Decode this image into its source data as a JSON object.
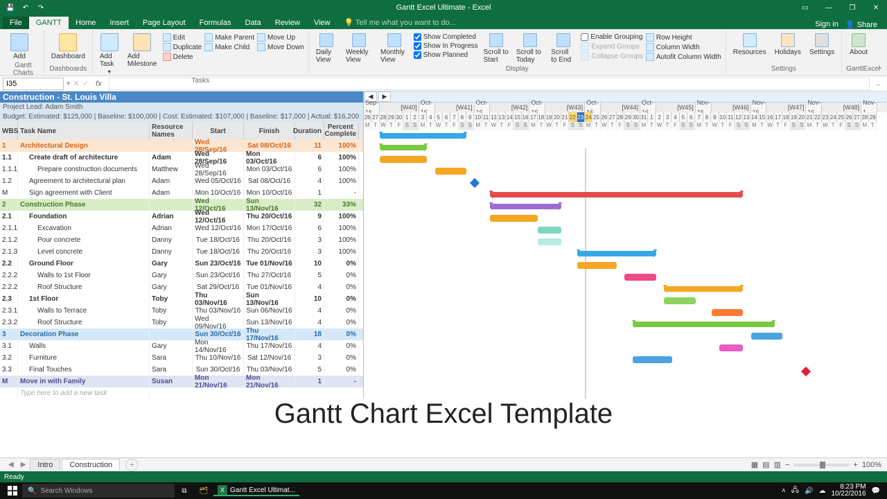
{
  "titlebar": {
    "title": "Gantt Excel Ultimate - Excel",
    "signin": "Sign in",
    "share": "Share"
  },
  "tabs": [
    "File",
    "GANTT",
    "Home",
    "Insert",
    "Page Layout",
    "Formulas",
    "Data",
    "Review",
    "View"
  ],
  "tell_me": "Tell me what you want to do...",
  "ribbon": {
    "gantt_charts": {
      "add": "Add",
      "label": "Gantt Charts"
    },
    "dashboards": {
      "dashboard": "Dashboard",
      "label": "Dashboards"
    },
    "tasks_big": {
      "add_task": "Add Task",
      "add_milestone": "Add Milestone"
    },
    "tasks_cmds": [
      "Edit",
      "Make Parent",
      "Move Up",
      "Duplicate",
      "Make Child",
      "Move Down",
      "Delete"
    ],
    "tasks_label": "Tasks",
    "views": [
      "Daily View",
      "Weekly View",
      "Monthly View"
    ],
    "display_checks": [
      "Show Completed",
      "Show In Progress",
      "Show Planned"
    ],
    "display_label": "Display",
    "scroll": [
      "Scroll to Start",
      "Scroll to Today",
      "Scroll to End"
    ],
    "grouping": [
      "Enable Grouping",
      "Expand Groups",
      "Collapse Groups"
    ],
    "row_cmds": [
      "Row Height",
      "Column Width",
      "Autofit Column Width"
    ],
    "resources": "Resources",
    "holidays": "Holidays",
    "settings": "Settings",
    "settings_label": "Settings",
    "about": "About",
    "about_label": "GanttExcel"
  },
  "formula_bar": {
    "name_box": "I35",
    "fx": "fx"
  },
  "project": {
    "title": "Construction - St. Louis Villa",
    "lead": "Project Lead: Adam Smith",
    "budget": "Budget:  Estimated: $125,000 |  Baseline: $100,000 |  Cost:  Estimated: $107,000 |  Baseline: $17,000 |  Actual: $16,200"
  },
  "columns": {
    "wbs": "WBS",
    "task": "Task Name",
    "res": "Resource Names",
    "start": "Start",
    "finish": "Finish",
    "dur": "Duration",
    "pct": "Percent Complete"
  },
  "placeholder_row": "Type here to add a new task",
  "rows": [
    {
      "wbs": "1",
      "task": "Architectural Design",
      "res": "",
      "start": "Wed 28/Sep/16",
      "finish": "Sat 08/Oct/16",
      "dur": "11",
      "pct": "100%",
      "cls": "phase-orange",
      "i": 0
    },
    {
      "wbs": "1.1",
      "task": "Create draft of architecture",
      "res": "Adam",
      "start": "Wed 28/Sep/16",
      "finish": "Mon 03/Oct/16",
      "dur": "6",
      "pct": "100%",
      "cls": "bold",
      "i": 1
    },
    {
      "wbs": "1.1.1",
      "task": "Prepare construction documents",
      "res": "Matthew",
      "start": "Wed 28/Sep/16",
      "finish": "Mon 03/Oct/16",
      "dur": "6",
      "pct": "100%",
      "i": 2
    },
    {
      "wbs": "1.2",
      "task": "Agreement to architectural plan",
      "res": "Adam",
      "start": "Wed 05/Oct/16",
      "finish": "Sat 08/Oct/16",
      "dur": "4",
      "pct": "100%",
      "i": 1
    },
    {
      "wbs": "M",
      "task": "Sign agreement with Client",
      "res": "Adam",
      "start": "Mon 10/Oct/16",
      "finish": "Mon 10/Oct/16",
      "dur": "1",
      "pct": "-",
      "i": 1
    },
    {
      "wbs": "2",
      "task": "Construction Phase",
      "res": "",
      "start": "Wed 12/Oct/16",
      "finish": "Sun 13/Nov/16",
      "dur": "32",
      "pct": "33%",
      "cls": "phase-green",
      "i": 0
    },
    {
      "wbs": "2.1",
      "task": "Foundation",
      "res": "Adrian",
      "start": "Wed 12/Oct/16",
      "finish": "Thu 20/Oct/16",
      "dur": "9",
      "pct": "100%",
      "cls": "bold",
      "i": 1
    },
    {
      "wbs": "2.1.1",
      "task": "Excavation",
      "res": "Adrian",
      "start": "Wed 12/Oct/16",
      "finish": "Mon 17/Oct/16",
      "dur": "6",
      "pct": "100%",
      "i": 2
    },
    {
      "wbs": "2.1.2",
      "task": "Pour concrete",
      "res": "Danny",
      "start": "Tue 18/Oct/16",
      "finish": "Thu 20/Oct/16",
      "dur": "3",
      "pct": "100%",
      "i": 2
    },
    {
      "wbs": "2.1.3",
      "task": "Level concrete",
      "res": "Danny",
      "start": "Tue 18/Oct/16",
      "finish": "Thu 20/Oct/16",
      "dur": "3",
      "pct": "100%",
      "i": 2
    },
    {
      "wbs": "2.2",
      "task": "Ground Floor",
      "res": "Gary",
      "start": "Sun 23/Oct/16",
      "finish": "Tue 01/Nov/16",
      "dur": "10",
      "pct": "0%",
      "cls": "bold",
      "i": 1
    },
    {
      "wbs": "2.2.2",
      "task": "Walls to 1st Floor",
      "res": "Gary",
      "start": "Sun 23/Oct/16",
      "finish": "Thu 27/Oct/16",
      "dur": "5",
      "pct": "0%",
      "i": 2
    },
    {
      "wbs": "2.2.2",
      "task": "Roof Structure",
      "res": "Gary",
      "start": "Sat 29/Oct/16",
      "finish": "Tue 01/Nov/16",
      "dur": "4",
      "pct": "0%",
      "i": 2
    },
    {
      "wbs": "2.3",
      "task": "1st Floor",
      "res": "Toby",
      "start": "Thu 03/Nov/16",
      "finish": "Sun 13/Nov/16",
      "dur": "10",
      "pct": "0%",
      "cls": "bold",
      "i": 1
    },
    {
      "wbs": "2.3.1",
      "task": "Walls to Terrace",
      "res": "Toby",
      "start": "Thu 03/Nov/16",
      "finish": "Sun 06/Nov/16",
      "dur": "4",
      "pct": "0%",
      "i": 2
    },
    {
      "wbs": "2.3.2",
      "task": "Roof Structure",
      "res": "Toby",
      "start": "Wed 09/Nov/16",
      "finish": "Sun 13/Nov/16",
      "dur": "4",
      "pct": "0%",
      "i": 2
    },
    {
      "wbs": "3",
      "task": "Decoration Phase",
      "res": "",
      "start": "Sun 30/Oct/16",
      "finish": "Thu 17/Nov/16",
      "dur": "18",
      "pct": "0%",
      "cls": "phase-blue",
      "i": 0
    },
    {
      "wbs": "3.1",
      "task": "Walls",
      "res": "Gary",
      "start": "Mon 14/Nov/16",
      "finish": "Thu 17/Nov/16",
      "dur": "4",
      "pct": "0%",
      "i": 1
    },
    {
      "wbs": "3.2",
      "task": "Furniture",
      "res": "Sara",
      "start": "Thu 10/Nov/16",
      "finish": "Sat 12/Nov/16",
      "dur": "3",
      "pct": "0%",
      "i": 1
    },
    {
      "wbs": "3.3",
      "task": "Final Touches",
      "res": "Sara",
      "start": "Sun 30/Oct/16",
      "finish": "Thu 03/Nov/16",
      "dur": "5",
      "pct": "0%",
      "i": 1
    },
    {
      "wbs": "M",
      "task": "Move in with Family",
      "res": "Susan",
      "start": "Mon 21/Nov/16",
      "finish": "Mon 21/Nov/16",
      "dur": "1",
      "pct": "-",
      "cls": "phase-lilac",
      "i": 0
    }
  ],
  "timeline": {
    "start_day_index": 0,
    "visible_days": 65,
    "day_width": 11.4,
    "today_index": 28,
    "weeks": [
      {
        "label": "Sep-16",
        "w": "",
        "len": 2
      },
      {
        "label": "",
        "w": "[W40]",
        "len": 5
      },
      {
        "label": "Oct-16",
        "w": "",
        "len": 2
      },
      {
        "label": "",
        "w": "[W41]",
        "len": 5
      },
      {
        "label": "Oct-16",
        "w": "",
        "len": 2
      },
      {
        "label": "",
        "w": "[W42]",
        "len": 5
      },
      {
        "label": "Oct-16",
        "w": "",
        "len": 2
      },
      {
        "label": "",
        "w": "[W43]",
        "len": 5
      },
      {
        "label": "Oct-16",
        "w": "",
        "len": 2
      },
      {
        "label": "",
        "w": "[W44]",
        "len": 5
      },
      {
        "label": "Oct-16",
        "w": "",
        "len": 2
      },
      {
        "label": "",
        "w": "[W45]",
        "len": 5
      },
      {
        "label": "Nov-16",
        "w": "",
        "len": 2
      },
      {
        "label": "",
        "w": "[W46]",
        "len": 5
      },
      {
        "label": "Nov-16",
        "w": "",
        "len": 2
      },
      {
        "label": "",
        "w": "[W47]",
        "len": 5
      },
      {
        "label": "Nov-16",
        "w": "",
        "len": 2
      },
      {
        "label": "",
        "w": "[W48]",
        "len": 5
      },
      {
        "label": "Nov-1",
        "w": "",
        "len": 2
      }
    ],
    "day_letters": [
      "M",
      "T",
      "W",
      "T",
      "F",
      "S",
      "S"
    ]
  },
  "chart_data": {
    "type": "gantt",
    "x_unit": "days",
    "start_date": "2016-09-26",
    "tasks": [
      {
        "row": 0,
        "type": "summary",
        "start": 2,
        "dur": 11,
        "color": "#35a7e6"
      },
      {
        "row": 1,
        "type": "summary",
        "start": 2,
        "dur": 6,
        "color": "#7ac943"
      },
      {
        "row": 2,
        "type": "bar",
        "start": 2,
        "dur": 6,
        "color": "#f5a623"
      },
      {
        "row": 3,
        "type": "bar",
        "start": 9,
        "dur": 4,
        "color": "#f5a623"
      },
      {
        "row": 4,
        "type": "milestone",
        "start": 14,
        "color": "#1f77d4"
      },
      {
        "row": 5,
        "type": "summary",
        "start": 16,
        "dur": 32,
        "color": "#e24c4c"
      },
      {
        "row": 6,
        "type": "summary",
        "start": 16,
        "dur": 9,
        "color": "#9d6bd8"
      },
      {
        "row": 7,
        "type": "bar",
        "start": 16,
        "dur": 6,
        "color": "#f5a623"
      },
      {
        "row": 8,
        "type": "bar",
        "start": 22,
        "dur": 3,
        "color": "#7ed6c1"
      },
      {
        "row": 9,
        "type": "bar",
        "start": 22,
        "dur": 3,
        "color": "#b7ece2"
      },
      {
        "row": 10,
        "type": "summary",
        "start": 27,
        "dur": 10,
        "color": "#35a7e6"
      },
      {
        "row": 11,
        "type": "bar",
        "start": 27,
        "dur": 5,
        "color": "#f5a623"
      },
      {
        "row": 12,
        "type": "bar",
        "start": 33,
        "dur": 4,
        "color": "#ee4b83"
      },
      {
        "row": 13,
        "type": "summary",
        "start": 38,
        "dur": 10,
        "color": "#f5a623"
      },
      {
        "row": 14,
        "type": "bar",
        "start": 38,
        "dur": 4,
        "color": "#8ed35f"
      },
      {
        "row": 15,
        "type": "bar",
        "start": 44,
        "dur": 4,
        "color": "#ff7a33"
      },
      {
        "row": 16,
        "type": "summary",
        "start": 34,
        "dur": 18,
        "color": "#7ac943"
      },
      {
        "row": 17,
        "type": "bar",
        "start": 49,
        "dur": 4,
        "color": "#4aa3e0"
      },
      {
        "row": 18,
        "type": "bar",
        "start": 45,
        "dur": 3,
        "color": "#e85cc4"
      },
      {
        "row": 19,
        "type": "bar",
        "start": 34,
        "dur": 5,
        "color": "#4aa3e0"
      },
      {
        "row": 20,
        "type": "milestone",
        "start": 56,
        "color": "#e21f3a"
      }
    ]
  },
  "big_caption": "Gantt Chart Excel Template",
  "sheet_tabs": [
    "Intro",
    "Construction"
  ],
  "active_sheet": 1,
  "status_ready": "Ready",
  "zoom": "100%",
  "taskbar": {
    "search_placeholder": "Search Windows",
    "excel_task": "Gantt Excel Ultimat...",
    "time": "8:23 PM",
    "date": "10/22/2016"
  }
}
